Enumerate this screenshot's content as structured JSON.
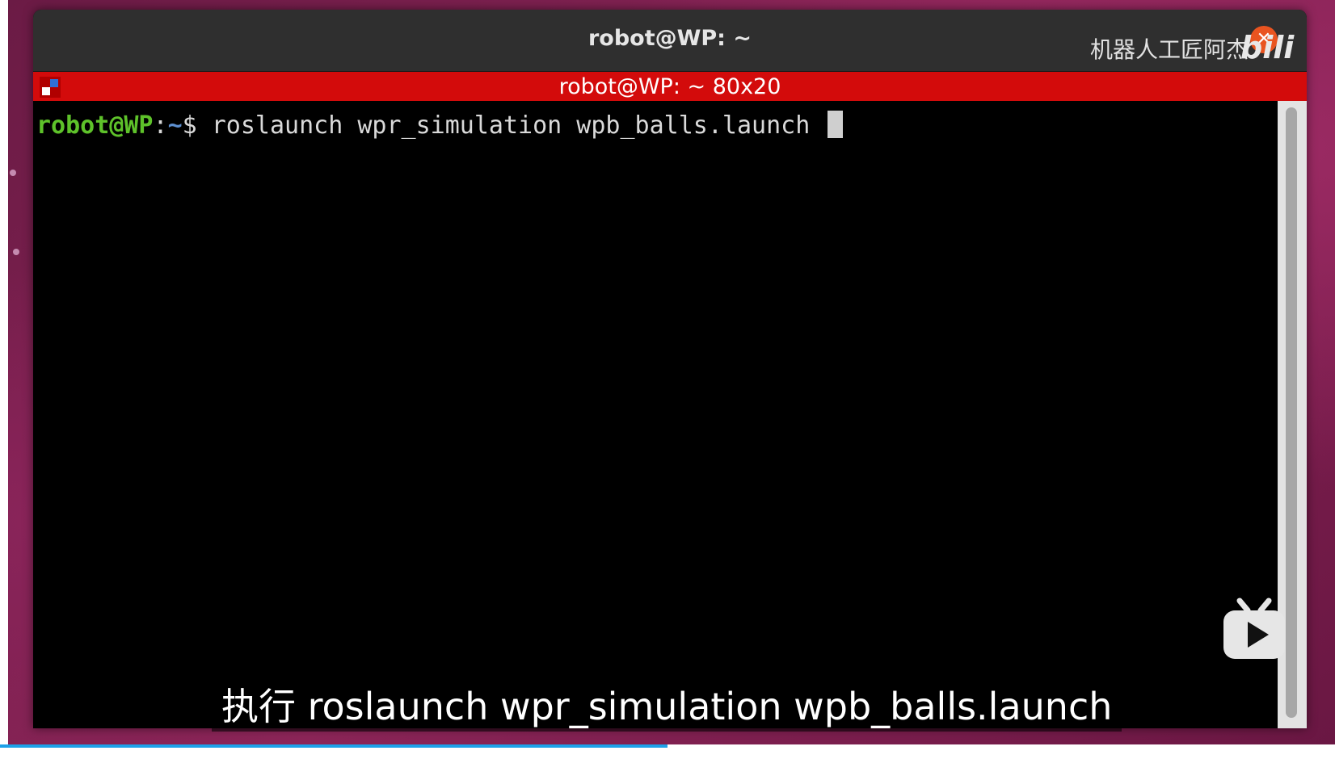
{
  "window": {
    "title": "robot@WP: ~",
    "watermark": "机器人工匠阿杰",
    "close_icon": "✕"
  },
  "tab": {
    "title": "robot@WP: ~ 80x20"
  },
  "terminal": {
    "prompt_user": "robot@WP",
    "prompt_colon": ":",
    "prompt_path": "~",
    "prompt_sign": "$ ",
    "command": "roslaunch wpr_simulation wpb_balls.launch "
  },
  "subtitle": {
    "text": "执行 roslaunch wpr_simulation wpb_balls.launch"
  },
  "player": {
    "progress_fraction": 0.5,
    "icons": [
      "bilibili-logo-icon",
      "bilibili-tv-play-icon",
      "close-icon",
      "terminal-tab-icon"
    ]
  },
  "colors": {
    "tab_bar": "#d30b0b",
    "prompt_user": "#5ec22a",
    "prompt_path": "#5d8fd0",
    "progress": "#1da1e8"
  }
}
